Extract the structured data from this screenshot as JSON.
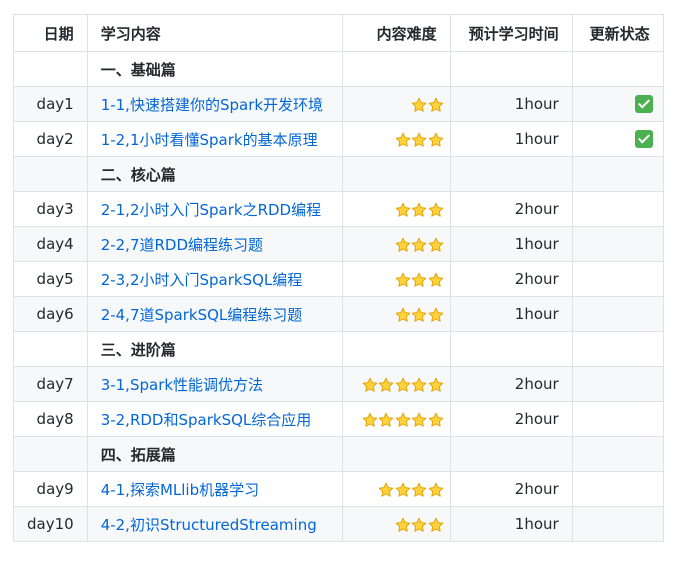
{
  "header": {
    "date": "日期",
    "content": "学习内容",
    "difficulty": "内容难度",
    "time": "预计学习时间",
    "status": "更新状态"
  },
  "colors": {
    "link": "#0366d6",
    "border": "#dfe2e5",
    "stripe": "#f6f8fa",
    "star_fill": "#ffd23c",
    "star_stroke": "#e0a000",
    "check": "#4caf50"
  },
  "rows": [
    {
      "type": "section",
      "title": "一、基础篇"
    },
    {
      "type": "item",
      "date": "day1",
      "title": "1-1,快速搭建你的Spark开发环境",
      "stars": 2,
      "time": "1hour",
      "done": true
    },
    {
      "type": "item",
      "date": "day2",
      "title": "1-2,1小时看懂Spark的基本原理",
      "stars": 3,
      "time": "1hour",
      "done": true
    },
    {
      "type": "section",
      "title": "二、核心篇"
    },
    {
      "type": "item",
      "date": "day3",
      "title": "2-1,2小时入门Spark之RDD编程",
      "stars": 3,
      "time": "2hour",
      "done": false
    },
    {
      "type": "item",
      "date": "day4",
      "title": "2-2,7道RDD编程练习题",
      "stars": 3,
      "time": "1hour",
      "done": false
    },
    {
      "type": "item",
      "date": "day5",
      "title": "2-3,2小时入门SparkSQL编程",
      "stars": 3,
      "time": "2hour",
      "done": false
    },
    {
      "type": "item",
      "date": "day6",
      "title": "2-4,7道SparkSQL编程练习题",
      "stars": 3,
      "time": "1hour",
      "done": false
    },
    {
      "type": "section",
      "title": "三、进阶篇"
    },
    {
      "type": "item",
      "date": "day7",
      "title": "3-1,Spark性能调优方法",
      "stars": 5,
      "time": "2hour",
      "done": false
    },
    {
      "type": "item",
      "date": "day8",
      "title": "3-2,RDD和SparkSQL综合应用",
      "stars": 5,
      "time": "2hour",
      "done": false
    },
    {
      "type": "section",
      "title": "四、拓展篇"
    },
    {
      "type": "item",
      "date": "day9",
      "title": "4-1,探索MLlib机器学习",
      "stars": 4,
      "time": "2hour",
      "done": false
    },
    {
      "type": "item",
      "date": "day10",
      "title": "4-2,初识StructuredStreaming",
      "stars": 3,
      "time": "1hour",
      "done": false
    }
  ]
}
